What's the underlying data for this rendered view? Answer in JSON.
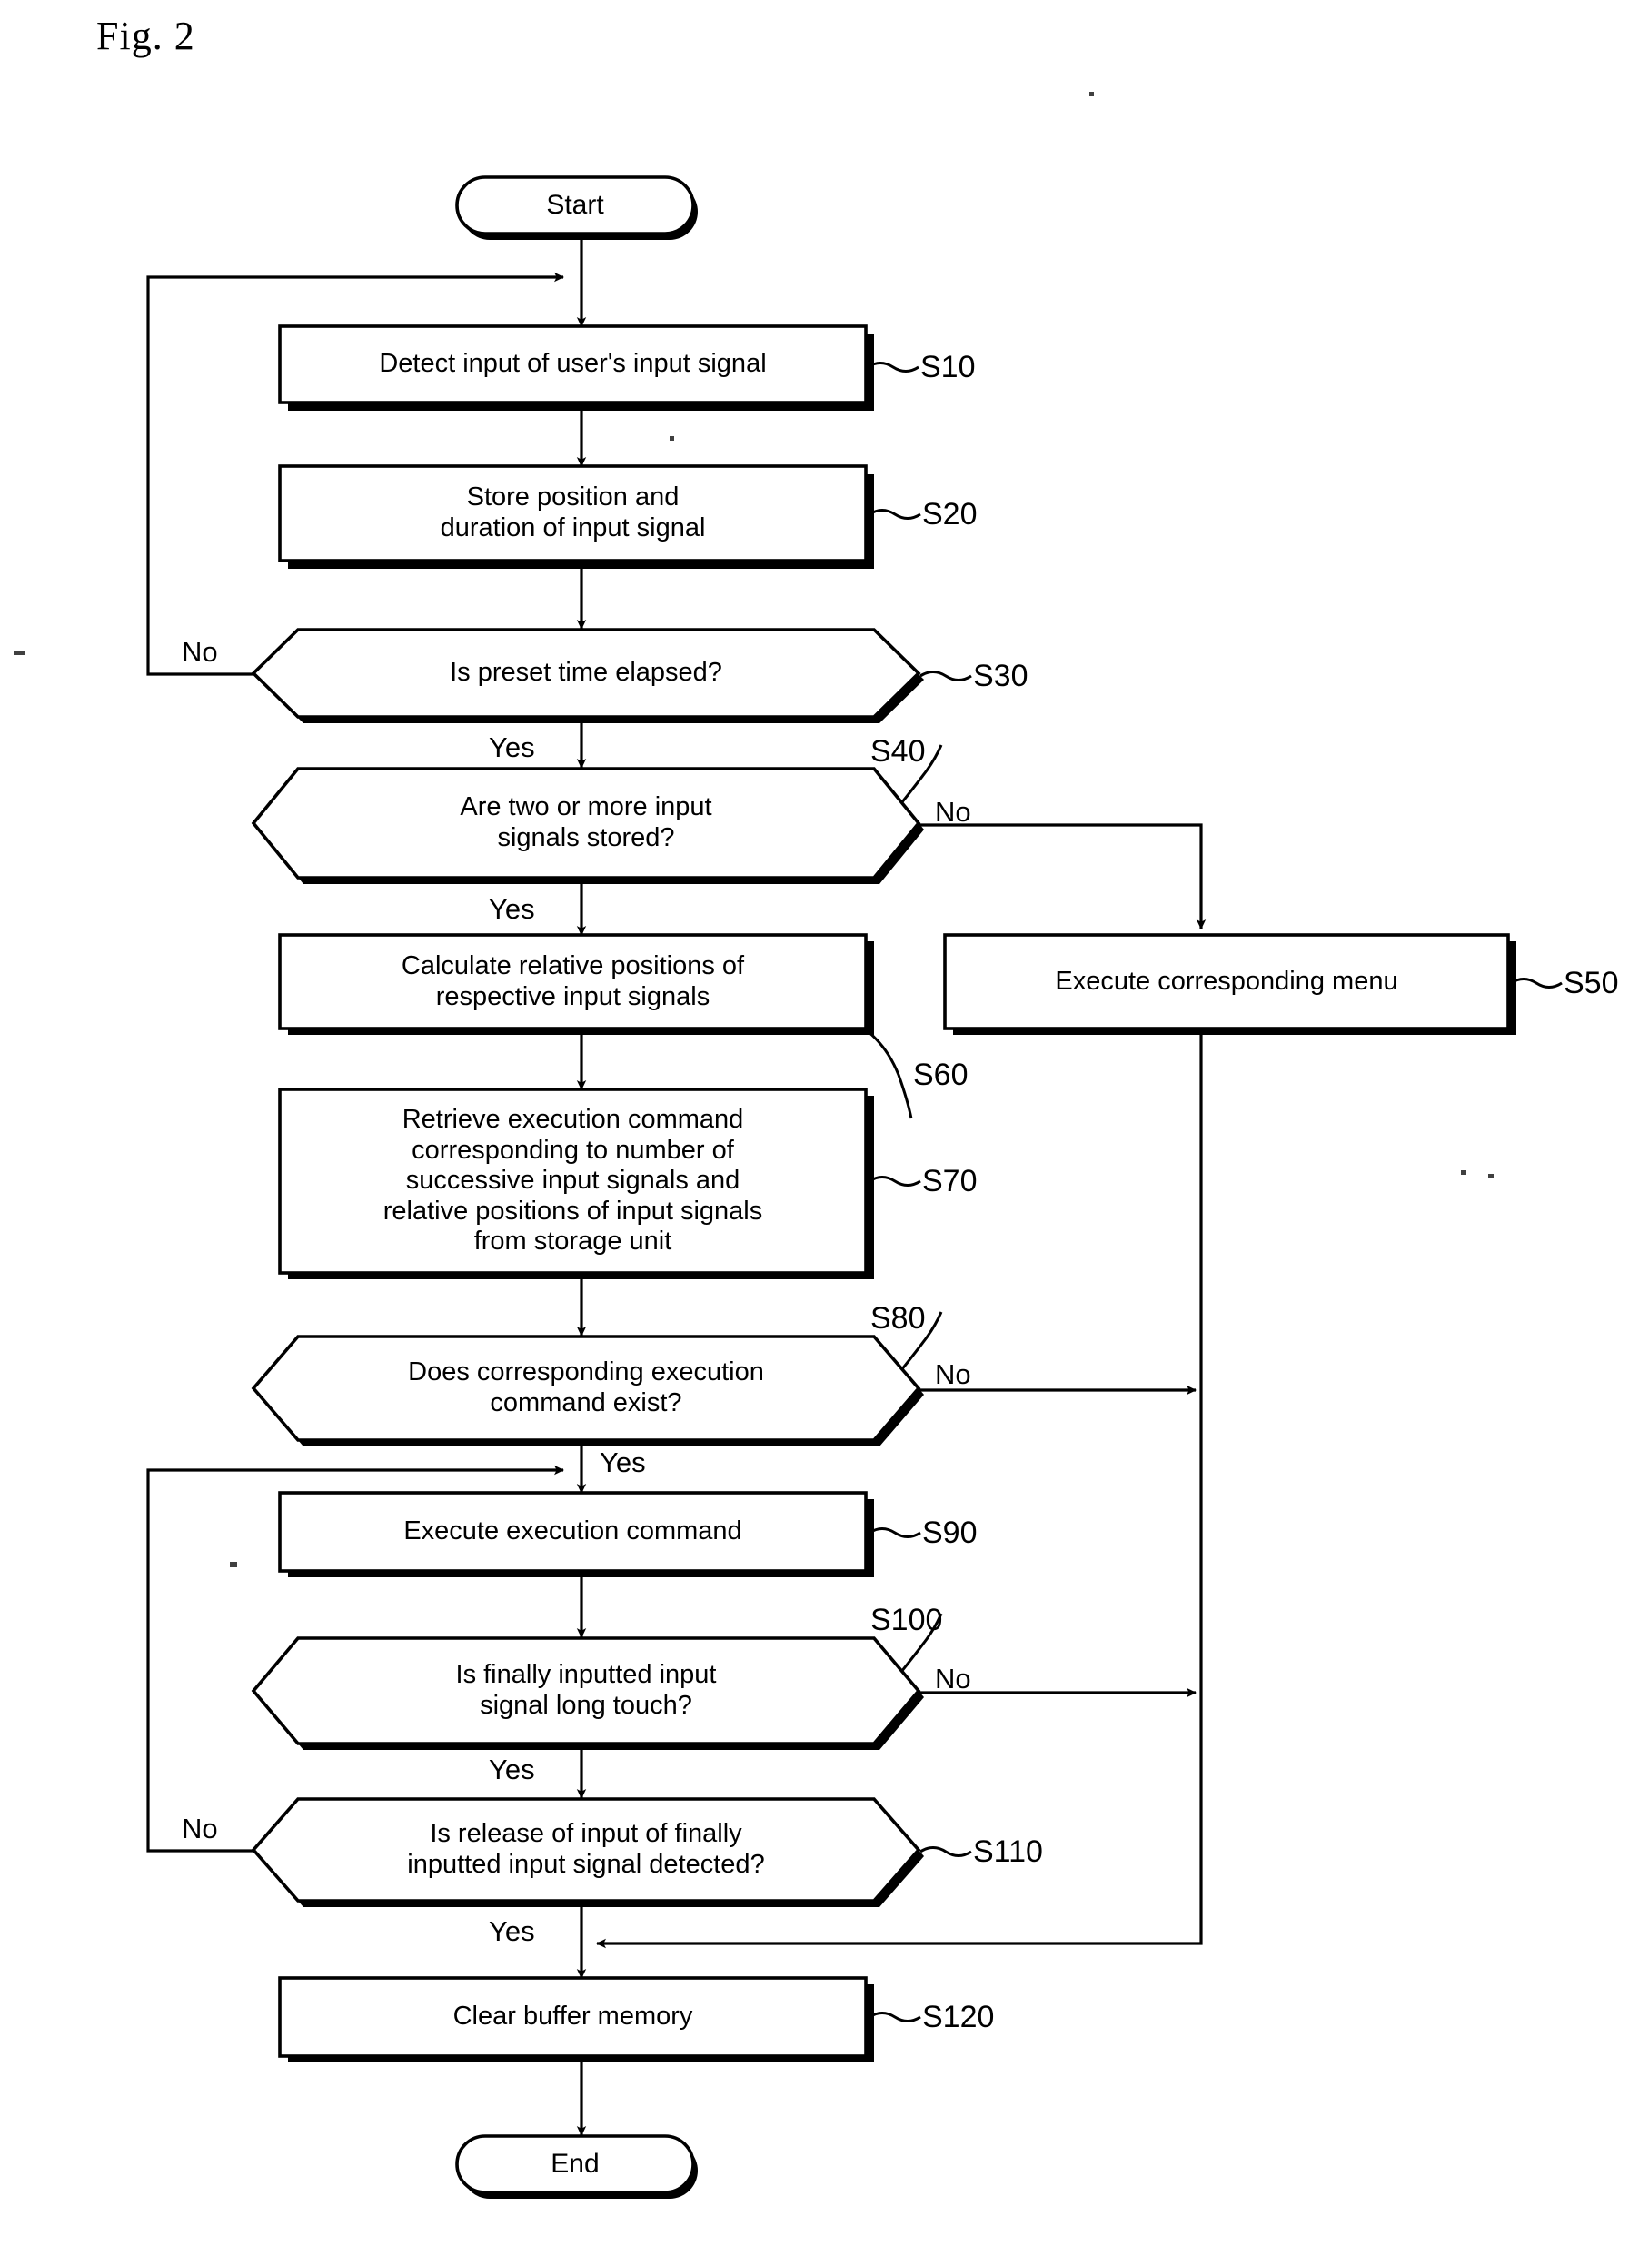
{
  "figure": {
    "title": "Fig. 2",
    "type": "flowchart",
    "terminators": {
      "start": "Start",
      "end": "End"
    },
    "nodes": [
      {
        "id": "S10",
        "ref": "S10",
        "shape": "process",
        "text": "Detect input of user's input signal"
      },
      {
        "id": "S20",
        "ref": "S20",
        "shape": "process",
        "text": "Store position and\nduration of input signal"
      },
      {
        "id": "S30",
        "ref": "S30",
        "shape": "decision",
        "text": "Is preset time elapsed?"
      },
      {
        "id": "S40",
        "ref": "S40",
        "shape": "decision",
        "text": "Are two or more input\nsignals stored?"
      },
      {
        "id": "S50",
        "ref": "S50",
        "shape": "process",
        "text": "Execute corresponding menu"
      },
      {
        "id": "S60",
        "ref": "S60",
        "shape": "process",
        "text": "Calculate relative positions of\nrespective input signals"
      },
      {
        "id": "S70",
        "ref": "S70",
        "shape": "process",
        "text": "Retrieve execution command\ncorresponding to number of\nsuccessive input signals and\nrelative positions of input signals\nfrom storage unit"
      },
      {
        "id": "S80",
        "ref": "S80",
        "shape": "decision",
        "text": "Does corresponding execution\ncommand exist?"
      },
      {
        "id": "S90",
        "ref": "S90",
        "shape": "process",
        "text": "Execute execution command"
      },
      {
        "id": "S100",
        "ref": "S100",
        "shape": "decision",
        "text": "Is finally inputted input\nsignal long touch?"
      },
      {
        "id": "S110",
        "ref": "S110",
        "shape": "decision",
        "text": "Is release of input of finally\ninputted input signal detected?"
      },
      {
        "id": "S120",
        "ref": "S120",
        "shape": "process",
        "text": "Clear buffer memory"
      }
    ],
    "edge_labels": {
      "s30_no": "No",
      "s30_yes": "Yes",
      "s40_no": "No",
      "s40_yes": "Yes",
      "s80_no": "No",
      "s80_yes": "Yes",
      "s100_no": "No",
      "s100_yes": "Yes",
      "s110_no": "No",
      "s110_yes": "Yes"
    },
    "colors": {
      "ink": "#000000",
      "paper": "#ffffff"
    }
  }
}
